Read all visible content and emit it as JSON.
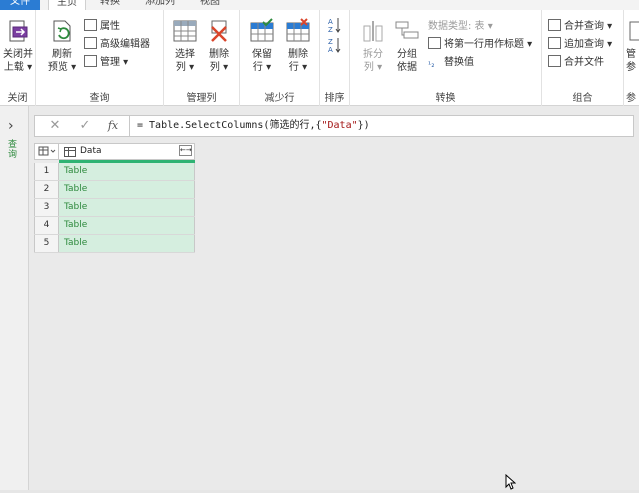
{
  "tabs": [
    "文件",
    "主页",
    "转换",
    "添加列",
    "视图"
  ],
  "ribbon": {
    "groups": {
      "close": "关闭",
      "query": "查询",
      "manage_cols": "管理列",
      "reduce_rows": "减少行",
      "sort": "排序",
      "transform": "转换",
      "combine": "组合",
      "params": "参"
    },
    "close_apply": [
      "关闭并",
      "上载 ▾"
    ],
    "refresh": [
      "刷新",
      "预览 ▾"
    ],
    "properties": "属性",
    "advanced_editor": "高级编辑器",
    "manage": "管理 ▾",
    "choose_cols": [
      "选择",
      "列 ▾"
    ],
    "remove_cols": [
      "删除",
      "列 ▾"
    ],
    "keep_rows": [
      "保留",
      "行 ▾"
    ],
    "remove_rows": [
      "删除",
      "行 ▾"
    ],
    "split_col": [
      "拆分",
      "列 ▾"
    ],
    "group_by": [
      "分组",
      "依据"
    ],
    "data_type": "数据类型: 表 ▾",
    "first_row_header": "将第一行用作标题 ▾",
    "replace_values": "替换值",
    "merge_queries": "合并查询 ▾",
    "append_queries": "追加查询 ▾",
    "combine_files": "合并文件",
    "manage_params": [
      "管",
      "参"
    ]
  },
  "left_pane": {
    "label": "查询"
  },
  "formula_bar": {
    "prefix": "= Table.SelectColumns(筛选的行,{",
    "string": "\"Data\"",
    "suffix": "})"
  },
  "grid": {
    "column": "Data",
    "rows": [
      {
        "n": "1",
        "v": "Table"
      },
      {
        "n": "2",
        "v": "Table"
      },
      {
        "n": "3",
        "v": "Table"
      },
      {
        "n": "4",
        "v": "Table"
      },
      {
        "n": "5",
        "v": "Table"
      }
    ]
  }
}
